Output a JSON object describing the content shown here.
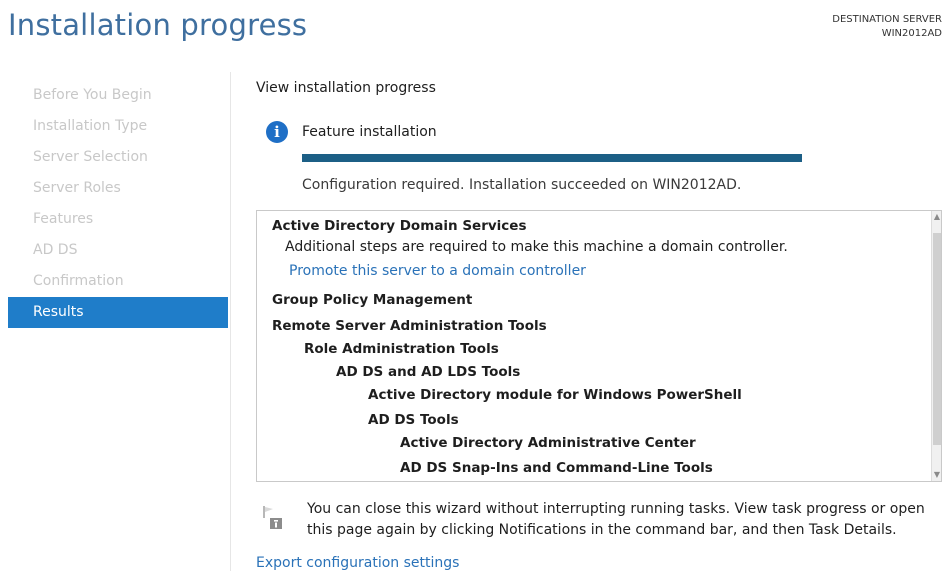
{
  "header": {
    "title": "Installation progress",
    "destination_label": "DESTINATION SERVER",
    "destination_value": "WIN2012AD"
  },
  "sidebar": {
    "items": [
      {
        "label": "Before You Begin",
        "active": false
      },
      {
        "label": "Installation Type",
        "active": false
      },
      {
        "label": "Server Selection",
        "active": false
      },
      {
        "label": "Server Roles",
        "active": false
      },
      {
        "label": "Features",
        "active": false
      },
      {
        "label": "AD DS",
        "active": false
      },
      {
        "label": "Confirmation",
        "active": false
      },
      {
        "label": "Results",
        "active": true
      }
    ]
  },
  "main": {
    "heading": "View installation progress",
    "feature_installation": {
      "icon": "info-icon",
      "label": "Feature installation",
      "progress_fraction": 1.0,
      "status": "Configuration required. Installation succeeded on WIN2012AD."
    },
    "results": [
      {
        "text": "Active Directory Domain Services",
        "type": "heading"
      },
      {
        "text": "Additional steps are required to make this machine a domain controller.",
        "type": "text"
      },
      {
        "text": "Promote this server to a domain controller",
        "type": "link"
      },
      {
        "text": "Group Policy Management",
        "type": "heading"
      },
      {
        "text": "Remote Server Administration Tools",
        "type": "heading"
      },
      {
        "text": "Role Administration Tools",
        "type": "heading"
      },
      {
        "text": "AD DS and AD LDS Tools",
        "type": "heading"
      },
      {
        "text": "Active Directory module for Windows PowerShell",
        "type": "heading"
      },
      {
        "text": "AD DS Tools",
        "type": "heading"
      },
      {
        "text": "Active Directory Administrative Center",
        "type": "heading"
      },
      {
        "text": "AD DS Snap-Ins and Command-Line Tools",
        "type": "heading"
      }
    ],
    "note": {
      "icon": "flag-note-icon",
      "text": "You can close this wizard without interrupting running tasks. View task progress or open this page again by clicking Notifications in the command bar, and then Task Details."
    },
    "export_link": "Export configuration settings"
  },
  "colors": {
    "title": "#3f6f9f",
    "active_nav": "#1f7dc9",
    "progress_fill": "#1c5f86",
    "link": "#2a72b8",
    "info_icon": "#1f6fc6"
  }
}
